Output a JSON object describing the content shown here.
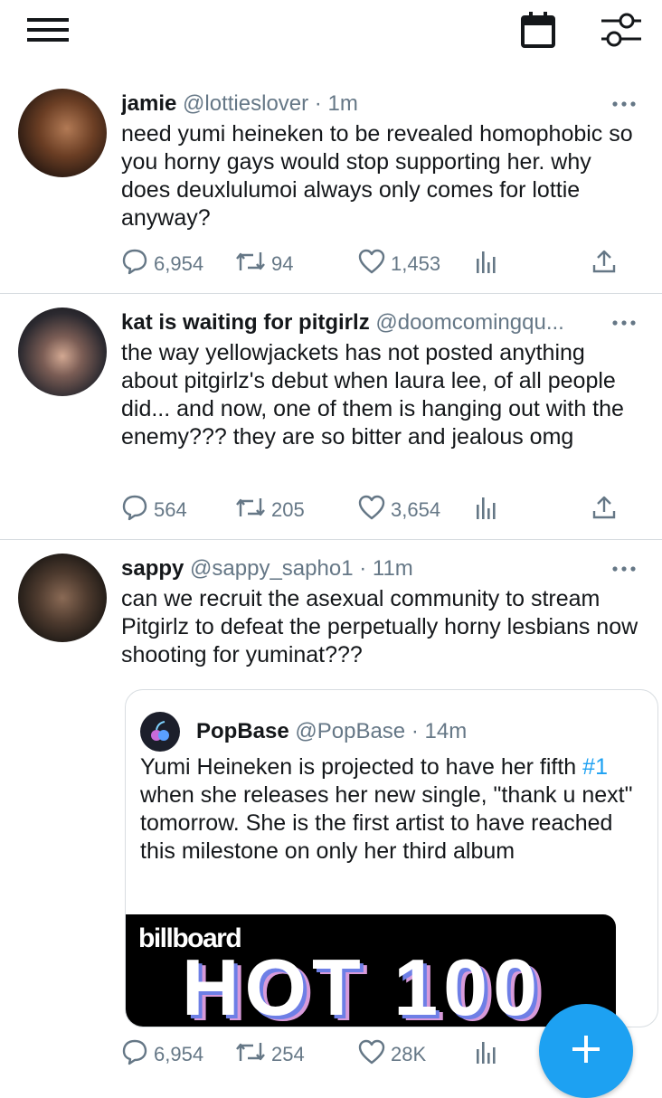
{
  "icons": {
    "menu": "hamburger-menu-icon",
    "calendar": "calendar-icon",
    "filter": "sliders-icon",
    "more": "more-dots-icon",
    "reply": "reply-bubble-icon",
    "retweet": "retweet-icon",
    "like": "heart-icon",
    "analytics": "analytics-bars-icon",
    "share": "share-upload-icon",
    "compose": "plus-icon"
  },
  "colors": {
    "accent": "#1da1f2",
    "muted": "#657786",
    "text": "#14171a",
    "divider": "#d8dde1"
  },
  "tweets": [
    {
      "name": "jamie",
      "handle": "@lottieslover",
      "separator": "·",
      "time": "1m",
      "text": "need yumi heineken to be revealed homophobic so you horny gays would stop supporting her. why does deuxlulumoi always only comes for lottie anyway?",
      "replies": "6,954",
      "retweets": "94",
      "likes": "1,453"
    },
    {
      "name": "kat is waiting for pitgirlz",
      "handle": "@doomcomingqu...",
      "separator": "",
      "time": "",
      "text": "the way yellowjackets has not posted anything about pitgirlz's debut when laura lee, of all people did... and now, one of them is hanging out with the enemy??? they are so bitter and jealous omg",
      "replies": "564",
      "retweets": "205",
      "likes": "3,654"
    },
    {
      "name": "sappy",
      "handle": "@sappy_sapho1",
      "separator": "·",
      "time": "11m",
      "text": "can we recruit the asexual community to stream Pitgirlz to defeat the perpetually horny lesbians now shooting for yuminat???",
      "replies": "6,954",
      "retweets": "254",
      "likes": "28K",
      "quote": {
        "name": "PopBase",
        "handle": "@PopBase",
        "separator": "·",
        "time": "14m",
        "text_before": "Yumi Heineken is projected to have her fifth ",
        "hashtag": "#1",
        "text_after": " when she releases her new single, \"thank u next\" tomorrow. She is the first artist to have reached this milestone on only her third album",
        "image_small": "billboard",
        "image_big": "HOT 100"
      }
    }
  ]
}
